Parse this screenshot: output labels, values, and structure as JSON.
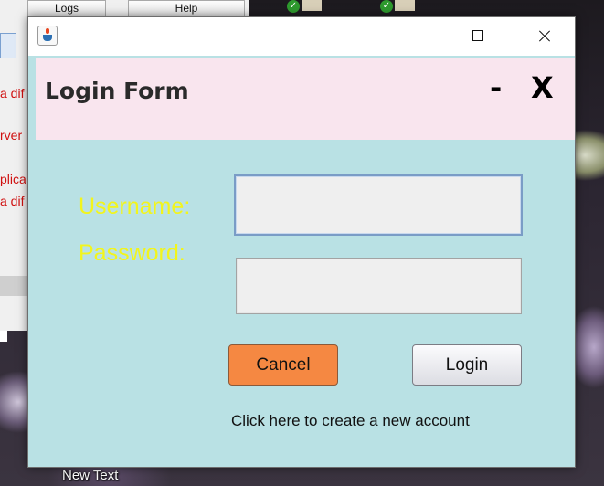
{
  "background": {
    "toolbar": {
      "logs_label": "Logs",
      "help_label": "Help"
    },
    "log_lines": [
      "a dif",
      "rver",
      "plica",
      "a dif"
    ],
    "desktop_icon_label": "New Text"
  },
  "window": {
    "title": "",
    "controls": {
      "minimize": "minimize",
      "maximize": "maximize",
      "close": "close"
    }
  },
  "form": {
    "title": "Login Form",
    "header_minimize": "-",
    "header_close": "X",
    "username_label": "Username:",
    "password_label": "Password:",
    "username_value": "",
    "password_value": "",
    "cancel_label": "Cancel",
    "login_label": "Login",
    "create_account_link": "Click here to create a new account"
  },
  "colors": {
    "content_bg": "#b9e1e4",
    "header_bg": "#f9e5ee",
    "label_color": "#f2f51c",
    "cancel_bg": "#f58842"
  },
  "icons": [
    "java-cup-icon",
    "minimize-icon",
    "maximize-icon",
    "close-icon",
    "check-badge-icon"
  ]
}
